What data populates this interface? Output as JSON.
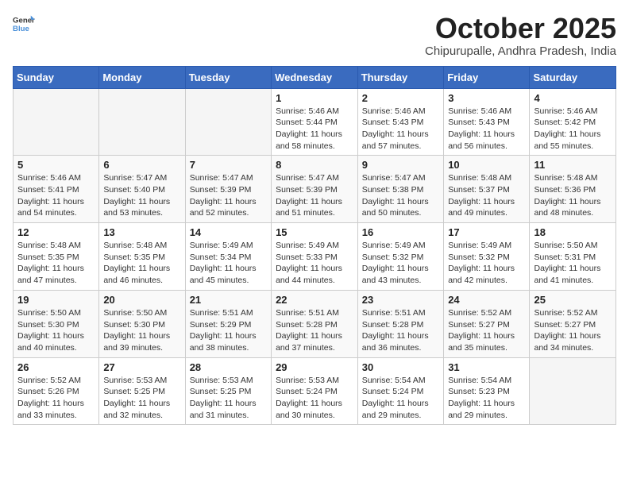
{
  "logo": {
    "general": "General",
    "blue": "Blue"
  },
  "header": {
    "title": "October 2025",
    "subtitle": "Chipurupalle, Andhra Pradesh, India"
  },
  "weekdays": [
    "Sunday",
    "Monday",
    "Tuesday",
    "Wednesday",
    "Thursday",
    "Friday",
    "Saturday"
  ],
  "weeks": [
    [
      {
        "day": "",
        "info": ""
      },
      {
        "day": "",
        "info": ""
      },
      {
        "day": "",
        "info": ""
      },
      {
        "day": "1",
        "info": "Sunrise: 5:46 AM\nSunset: 5:44 PM\nDaylight: 11 hours\nand 58 minutes."
      },
      {
        "day": "2",
        "info": "Sunrise: 5:46 AM\nSunset: 5:43 PM\nDaylight: 11 hours\nand 57 minutes."
      },
      {
        "day": "3",
        "info": "Sunrise: 5:46 AM\nSunset: 5:43 PM\nDaylight: 11 hours\nand 56 minutes."
      },
      {
        "day": "4",
        "info": "Sunrise: 5:46 AM\nSunset: 5:42 PM\nDaylight: 11 hours\nand 55 minutes."
      }
    ],
    [
      {
        "day": "5",
        "info": "Sunrise: 5:46 AM\nSunset: 5:41 PM\nDaylight: 11 hours\nand 54 minutes."
      },
      {
        "day": "6",
        "info": "Sunrise: 5:47 AM\nSunset: 5:40 PM\nDaylight: 11 hours\nand 53 minutes."
      },
      {
        "day": "7",
        "info": "Sunrise: 5:47 AM\nSunset: 5:39 PM\nDaylight: 11 hours\nand 52 minutes."
      },
      {
        "day": "8",
        "info": "Sunrise: 5:47 AM\nSunset: 5:39 PM\nDaylight: 11 hours\nand 51 minutes."
      },
      {
        "day": "9",
        "info": "Sunrise: 5:47 AM\nSunset: 5:38 PM\nDaylight: 11 hours\nand 50 minutes."
      },
      {
        "day": "10",
        "info": "Sunrise: 5:48 AM\nSunset: 5:37 PM\nDaylight: 11 hours\nand 49 minutes."
      },
      {
        "day": "11",
        "info": "Sunrise: 5:48 AM\nSunset: 5:36 PM\nDaylight: 11 hours\nand 48 minutes."
      }
    ],
    [
      {
        "day": "12",
        "info": "Sunrise: 5:48 AM\nSunset: 5:35 PM\nDaylight: 11 hours\nand 47 minutes."
      },
      {
        "day": "13",
        "info": "Sunrise: 5:48 AM\nSunset: 5:35 PM\nDaylight: 11 hours\nand 46 minutes."
      },
      {
        "day": "14",
        "info": "Sunrise: 5:49 AM\nSunset: 5:34 PM\nDaylight: 11 hours\nand 45 minutes."
      },
      {
        "day": "15",
        "info": "Sunrise: 5:49 AM\nSunset: 5:33 PM\nDaylight: 11 hours\nand 44 minutes."
      },
      {
        "day": "16",
        "info": "Sunrise: 5:49 AM\nSunset: 5:32 PM\nDaylight: 11 hours\nand 43 minutes."
      },
      {
        "day": "17",
        "info": "Sunrise: 5:49 AM\nSunset: 5:32 PM\nDaylight: 11 hours\nand 42 minutes."
      },
      {
        "day": "18",
        "info": "Sunrise: 5:50 AM\nSunset: 5:31 PM\nDaylight: 11 hours\nand 41 minutes."
      }
    ],
    [
      {
        "day": "19",
        "info": "Sunrise: 5:50 AM\nSunset: 5:30 PM\nDaylight: 11 hours\nand 40 minutes."
      },
      {
        "day": "20",
        "info": "Sunrise: 5:50 AM\nSunset: 5:30 PM\nDaylight: 11 hours\nand 39 minutes."
      },
      {
        "day": "21",
        "info": "Sunrise: 5:51 AM\nSunset: 5:29 PM\nDaylight: 11 hours\nand 38 minutes."
      },
      {
        "day": "22",
        "info": "Sunrise: 5:51 AM\nSunset: 5:28 PM\nDaylight: 11 hours\nand 37 minutes."
      },
      {
        "day": "23",
        "info": "Sunrise: 5:51 AM\nSunset: 5:28 PM\nDaylight: 11 hours\nand 36 minutes."
      },
      {
        "day": "24",
        "info": "Sunrise: 5:52 AM\nSunset: 5:27 PM\nDaylight: 11 hours\nand 35 minutes."
      },
      {
        "day": "25",
        "info": "Sunrise: 5:52 AM\nSunset: 5:27 PM\nDaylight: 11 hours\nand 34 minutes."
      }
    ],
    [
      {
        "day": "26",
        "info": "Sunrise: 5:52 AM\nSunset: 5:26 PM\nDaylight: 11 hours\nand 33 minutes."
      },
      {
        "day": "27",
        "info": "Sunrise: 5:53 AM\nSunset: 5:25 PM\nDaylight: 11 hours\nand 32 minutes."
      },
      {
        "day": "28",
        "info": "Sunrise: 5:53 AM\nSunset: 5:25 PM\nDaylight: 11 hours\nand 31 minutes."
      },
      {
        "day": "29",
        "info": "Sunrise: 5:53 AM\nSunset: 5:24 PM\nDaylight: 11 hours\nand 30 minutes."
      },
      {
        "day": "30",
        "info": "Sunrise: 5:54 AM\nSunset: 5:24 PM\nDaylight: 11 hours\nand 29 minutes."
      },
      {
        "day": "31",
        "info": "Sunrise: 5:54 AM\nSunset: 5:23 PM\nDaylight: 11 hours\nand 29 minutes."
      },
      {
        "day": "",
        "info": ""
      }
    ]
  ]
}
